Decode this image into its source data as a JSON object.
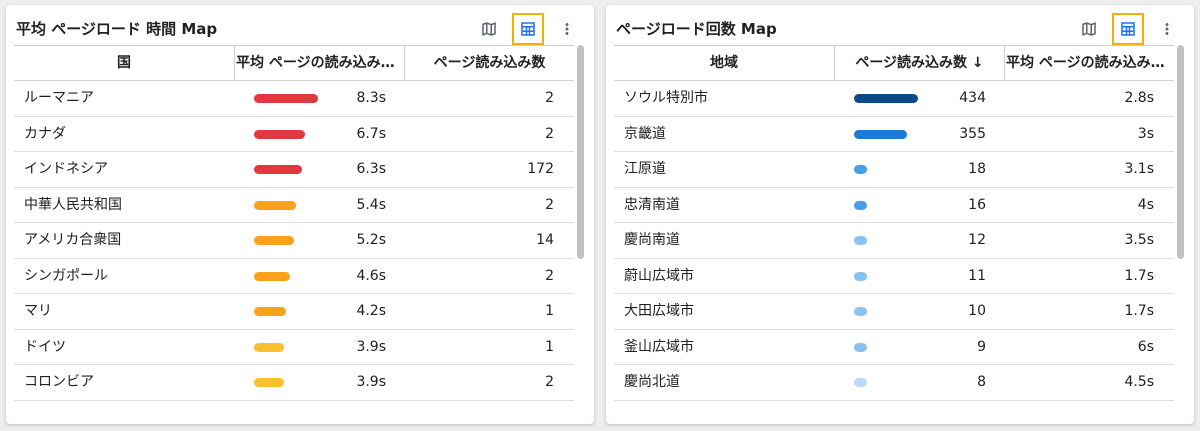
{
  "left_panel": {
    "title": "平均 ページロード 時間 Map",
    "columns": [
      "国",
      "平均 ページの読み込み時間",
      "ページ読み込み数"
    ],
    "rows": [
      {
        "name": "ルーマニア",
        "avg": "8.3s",
        "count": "2",
        "bar_fraction": 0.97,
        "bar_color": "#e0383c"
      },
      {
        "name": "カナダ",
        "avg": "6.7s",
        "count": "2",
        "bar_fraction": 0.78,
        "bar_color": "#e0383c"
      },
      {
        "name": "インドネシア",
        "avg": "6.3s",
        "count": "172",
        "bar_fraction": 0.73,
        "bar_color": "#e0383c"
      },
      {
        "name": "中華人民共和国",
        "avg": "5.4s",
        "count": "2",
        "bar_fraction": 0.63,
        "bar_color": "#f9a11b"
      },
      {
        "name": "アメリカ合衆国",
        "avg": "5.2s",
        "count": "14",
        "bar_fraction": 0.61,
        "bar_color": "#f9a11b"
      },
      {
        "name": "シンガポール",
        "avg": "4.6s",
        "count": "2",
        "bar_fraction": 0.54,
        "bar_color": "#f9a11b"
      },
      {
        "name": "マリ",
        "avg": "4.2s",
        "count": "1",
        "bar_fraction": 0.49,
        "bar_color": "#f9a11b"
      },
      {
        "name": "ドイツ",
        "avg": "3.9s",
        "count": "1",
        "bar_fraction": 0.46,
        "bar_color": "#fbc02d"
      },
      {
        "name": "コロンビア",
        "avg": "3.9s",
        "count": "2",
        "bar_fraction": 0.46,
        "bar_color": "#fbc02d"
      }
    ]
  },
  "right_panel": {
    "title": "ページロード回数 Map",
    "columns": [
      "地域",
      "ページ読み込み数 ↓",
      "平均 ページの読み込み時間"
    ],
    "rows": [
      {
        "name": "ソウル特別市",
        "count": "434",
        "avg": "2.8s",
        "bar_fraction": 0.97,
        "bar_color": "#0a4a86"
      },
      {
        "name": "京畿道",
        "count": "355",
        "avg": "3s",
        "bar_fraction": 0.8,
        "bar_color": "#1a7ad9"
      },
      {
        "name": "江原道",
        "count": "18",
        "avg": "3.1s",
        "bar_fraction": 0.2,
        "bar_color": "#4a9ee6"
      },
      {
        "name": "忠清南道",
        "count": "16",
        "avg": "4s",
        "bar_fraction": 0.2,
        "bar_color": "#4a9ee6"
      },
      {
        "name": "慶尚南道",
        "count": "12",
        "avg": "3.5s",
        "bar_fraction": 0.2,
        "bar_color": "#8cc2f0"
      },
      {
        "name": "蔚山広域市",
        "count": "11",
        "avg": "1.7s",
        "bar_fraction": 0.2,
        "bar_color": "#8cc2f0"
      },
      {
        "name": "大田広域市",
        "count": "10",
        "avg": "1.7s",
        "bar_fraction": 0.2,
        "bar_color": "#8cc2f0"
      },
      {
        "name": "釜山広域市",
        "count": "9",
        "avg": "6s",
        "bar_fraction": 0.2,
        "bar_color": "#8cc2f0"
      },
      {
        "name": "慶尚北道",
        "count": "8",
        "avg": "4.5s",
        "bar_fraction": 0.2,
        "bar_color": "#bcdaf6"
      }
    ]
  },
  "icons": {
    "map": "map-icon",
    "table": "table-icon",
    "more": "more-vert-icon"
  },
  "colors": {
    "active_outline": "#f2b100",
    "icon_active": "#1a73e8",
    "icon_idle": "#5f6368"
  }
}
